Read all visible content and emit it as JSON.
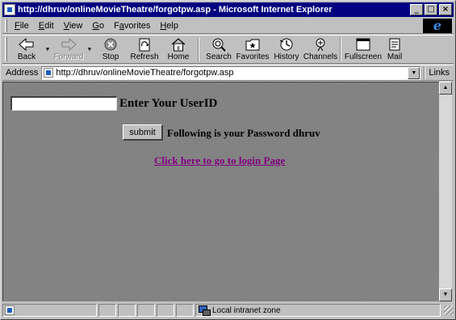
{
  "window": {
    "title": "http://dhruv/onlineMovieTheatre/forgotpw.asp - Microsoft Internet Explorer",
    "controls": {
      "minimize": "_",
      "maximize": "□",
      "close": "×"
    }
  },
  "menu": {
    "items": [
      {
        "key": "F",
        "rest": "ile"
      },
      {
        "key": "E",
        "rest": "dit"
      },
      {
        "key": "V",
        "rest": "iew"
      },
      {
        "key": "G",
        "rest": "o"
      },
      {
        "pre": "F",
        "key": "a",
        "rest": "vorites"
      },
      {
        "key": "H",
        "rest": "elp"
      }
    ],
    "logo": "e"
  },
  "toolbar": {
    "back": "Back",
    "forward": "Forward",
    "stop": "Stop",
    "refresh": "Refresh",
    "home": "Home",
    "search": "Search",
    "favorites": "Favorites",
    "history": "History",
    "channels": "Channels",
    "fullscreen": "Fullscreen",
    "mail": "Mail",
    "dropdown_glyph": "▼"
  },
  "address": {
    "label": "Address",
    "url": "http://dhruv/onlineMovieTheatre/forgotpw.asp",
    "links": "Links"
  },
  "page": {
    "userid_value": "",
    "userid_label": "Enter Your UserID",
    "submit_label": "submit",
    "password_text": "Following is your Password dhruv",
    "login_link": "Click here to go to login Page"
  },
  "scrollbar": {
    "up": "▲",
    "down": "▼"
  },
  "status": {
    "zone": "Local intranet zone"
  },
  "colors": {
    "titlebar": "#000080",
    "page_bg": "#858585",
    "visited_link": "#800080"
  }
}
